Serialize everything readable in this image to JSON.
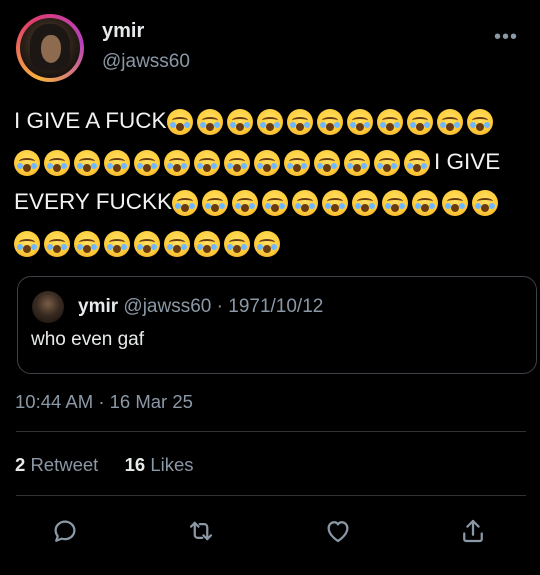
{
  "author": {
    "name": "ymir",
    "handle": "@jawss60",
    "avatar_icon": "avatar"
  },
  "more_icon": "more-icon",
  "tweet": {
    "lines": [
      {
        "before": "I GIVE A FUCK",
        "emoji": 11,
        "after": ""
      },
      {
        "before": "",
        "emoji": 14,
        "after": "I GIVE"
      },
      {
        "before": "EVERY FUCKK",
        "emoji": 11,
        "after": ""
      },
      {
        "before": "",
        "emoji": 9,
        "after": ""
      }
    ],
    "emoji_name": "loudly-crying-face-emoji"
  },
  "quote": {
    "name": "ymir",
    "handle": "@jawss60",
    "separator": "·",
    "date": "1971/10/12",
    "text": "who even gaf"
  },
  "timestamp": {
    "time": "10:44 AM",
    "separator": "·",
    "date": "16 Mar 25"
  },
  "stats": {
    "retweets_count": "2",
    "retweets_label": "Retweet",
    "likes_count": "16",
    "likes_label": "Likes"
  },
  "actions": [
    "reply-icon",
    "retweet-icon",
    "like-icon",
    "share-icon"
  ],
  "colors": {
    "background": "#000000",
    "text": "#e7e9ea",
    "muted": "#8b98a5",
    "border": "#2f3336"
  }
}
